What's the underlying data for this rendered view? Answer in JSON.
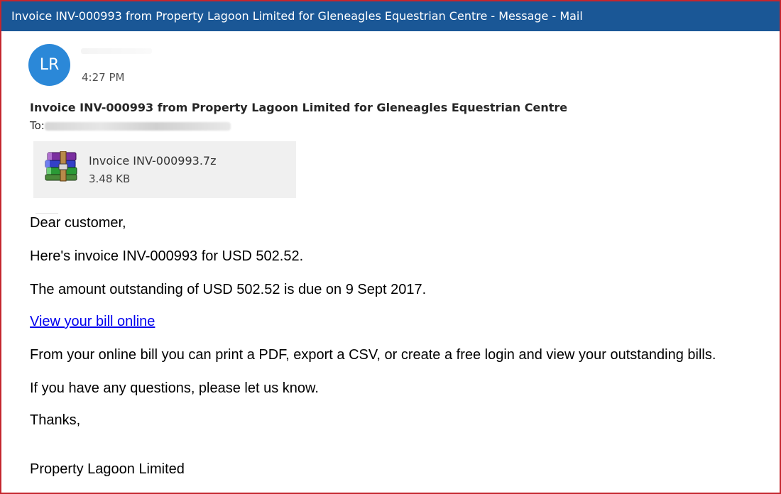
{
  "window": {
    "title": "Invoice INV-000993 from Property Lagoon Limited for Gleneagles Equestrian Centre - Message - Mail"
  },
  "colors": {
    "titlebar": "#1a5796",
    "avatar": "#2b88d8",
    "window_border": "#c4262e",
    "link": "#0000ee",
    "attachment_bg": "#f0f0f0"
  },
  "header": {
    "avatar_initials": "LR",
    "time": "4:27 PM",
    "subject": "Invoice INV-000993 from Property Lagoon Limited for Gleneagles Equestrian Centre",
    "to_label": "To:"
  },
  "attachment": {
    "icon": "winrar-archive-icon",
    "name": "Invoice INV-000993.7z",
    "size": "3.48 KB"
  },
  "body": {
    "greeting": "Dear customer,",
    "line1": "Here's invoice INV-000993 for USD 502.52.",
    "line2": "The amount outstanding of USD 502.52 is due on 9 Sept 2017.",
    "link_text": "View your bill online",
    "line3": "From your online bill you can print a PDF, export a CSV, or create a free login and view your outstanding bills.",
    "line4": "If you have any questions, please let us know.",
    "signoff": "Thanks,",
    "signature": "Property Lagoon Limited"
  }
}
